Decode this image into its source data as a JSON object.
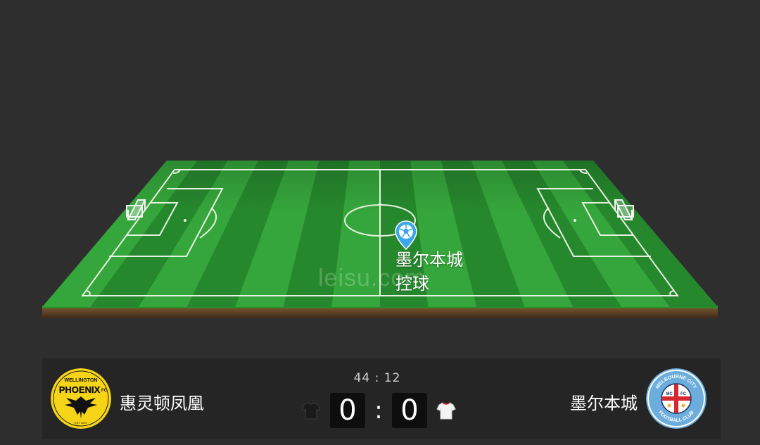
{
  "pitch": {
    "watermark": "leisu.com",
    "event": {
      "team": "墨尔本城",
      "action": "控球",
      "marker_icon": "football-pin-icon",
      "marker_color": "#3aa8e8"
    },
    "colors": {
      "grass_light": "#35a63b",
      "grass_dark": "#1f7a27",
      "lines": "#e6f2e0",
      "soil": "#6b4a2c"
    }
  },
  "scoreboard": {
    "clock": "44 : 12",
    "home": {
      "name": "惠灵顿凤凰",
      "score": "0",
      "logo_icon": "wellington-phoenix-logo",
      "logo_texts": [
        "WELLINGTON",
        "PHOENIX",
        "FC"
      ],
      "kit_icon": "dark-jersey-icon"
    },
    "separator": ":",
    "away": {
      "name": "墨尔本城",
      "score": "0",
      "logo_icon": "melbourne-city-logo",
      "logo_texts": [
        "MELBOURNE CITY",
        "FOOTBALL CLUB",
        "MC",
        "FC"
      ],
      "kit_icon": "white-jersey-icon"
    }
  }
}
